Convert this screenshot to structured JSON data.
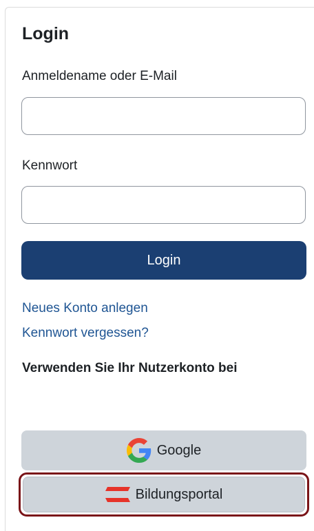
{
  "login": {
    "title": "Login",
    "username_label": "Anmeldename oder E-Mail",
    "username_value": "",
    "password_label": "Kennwort",
    "password_value": "",
    "submit_label": "Login"
  },
  "links": {
    "new_account": "Neues Konto anlegen",
    "forgot_password": "Kennwort vergessen?"
  },
  "sso": {
    "heading": "Verwenden Sie Ihr Nutzerkonto bei",
    "providers": [
      {
        "label": "Google",
        "icon": "google-icon"
      },
      {
        "label": "Bildungsportal",
        "icon": "austria-flag-icon"
      }
    ]
  },
  "colors": {
    "primary": "#1b3f72",
    "link": "#1f5593",
    "sso_background": "#ced4da",
    "focus_ring": "#7a1418"
  }
}
